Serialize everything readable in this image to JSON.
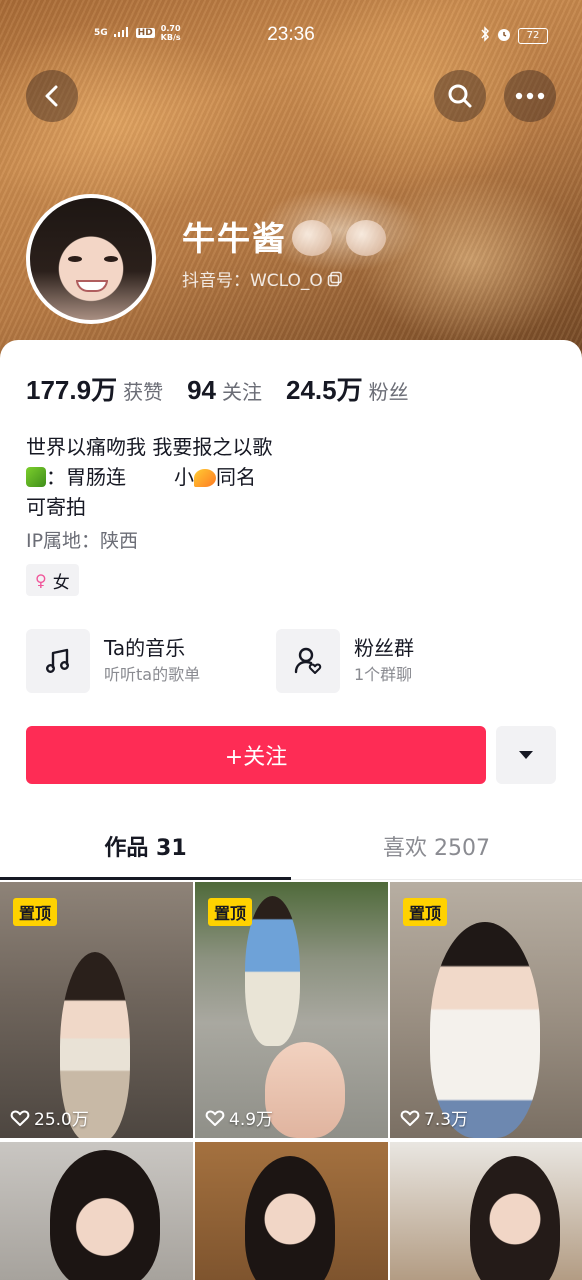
{
  "status_bar": {
    "network": "5G",
    "hd": "HD",
    "speed": "0.70",
    "speed_unit": "KB/s",
    "time": "23:36",
    "battery": "72"
  },
  "profile": {
    "name": "牛牛酱",
    "douyin_id": "抖音号：WCLO_O"
  },
  "stats": [
    {
      "value": "177.9万",
      "label": "获赞"
    },
    {
      "value": "94",
      "label": "关注"
    },
    {
      "value": "24.5万",
      "label": "粉丝"
    }
  ],
  "bio": {
    "line1": "世界以痛吻我 我要报之以歌",
    "line2_prefix": "：胃肠连",
    "line2_mid": "小",
    "line2_suffix": "同名",
    "line3": "可寄拍"
  },
  "ip_location": "IP属地：陕西",
  "gender": "女",
  "entries": {
    "music": {
      "title": "Ta的音乐",
      "subtitle": "听听ta的歌单",
      "icon": "music-note-icon"
    },
    "fans": {
      "title": "粉丝群",
      "subtitle": "1个群聊",
      "icon": "fan-group-icon"
    }
  },
  "follow_button": "+关注",
  "tabs": [
    {
      "label": "作品 31"
    },
    {
      "label": "喜欢 2507"
    }
  ],
  "videos": [
    {
      "pinned": "置顶",
      "likes": "25.0万"
    },
    {
      "pinned": "置顶",
      "likes": "4.9万"
    },
    {
      "pinned": "置顶",
      "likes": "7.3万"
    },
    {
      "pinned": "",
      "likes": ""
    },
    {
      "pinned": "",
      "likes": ""
    },
    {
      "pinned": "",
      "likes": ""
    }
  ],
  "colors": {
    "accent": "#fe2c55",
    "pin_badge": "#ffd200",
    "text_primary": "#161823",
    "text_secondary": "#6b6d76"
  }
}
